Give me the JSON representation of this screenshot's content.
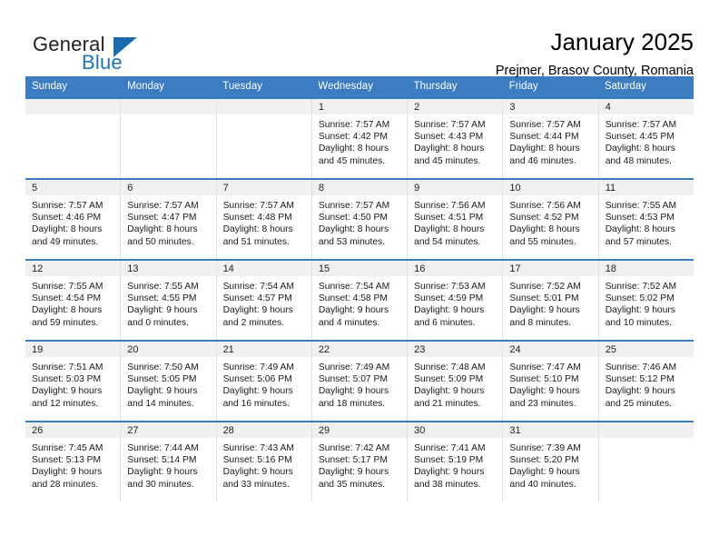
{
  "brand": {
    "name_part1": "General",
    "name_part2": "Blue",
    "triangle_color": "#1b6cb0",
    "blue_color": "#1b75bb"
  },
  "header": {
    "title": "January 2025",
    "subtitle": "Prejmer, Brasov County, Romania",
    "accent_color": "#3b7dc0"
  },
  "calendar": {
    "weekday_headers": [
      "Sunday",
      "Monday",
      "Tuesday",
      "Wednesday",
      "Thursday",
      "Friday",
      "Saturday"
    ],
    "labels": {
      "sunrise_prefix": "Sunrise:",
      "sunset_prefix": "Sunset:",
      "daylight_prefix": "Daylight:"
    },
    "weeks": [
      [
        {
          "day": "",
          "sunrise": "",
          "sunset": "",
          "daylight_line1": "",
          "daylight_line2": ""
        },
        {
          "day": "",
          "sunrise": "",
          "sunset": "",
          "daylight_line1": "",
          "daylight_line2": ""
        },
        {
          "day": "",
          "sunrise": "",
          "sunset": "",
          "daylight_line1": "",
          "daylight_line2": ""
        },
        {
          "day": "1",
          "sunrise": "Sunrise: 7:57 AM",
          "sunset": "Sunset: 4:42 PM",
          "daylight_line1": "Daylight: 8 hours",
          "daylight_line2": "and 45 minutes."
        },
        {
          "day": "2",
          "sunrise": "Sunrise: 7:57 AM",
          "sunset": "Sunset: 4:43 PM",
          "daylight_line1": "Daylight: 8 hours",
          "daylight_line2": "and 45 minutes."
        },
        {
          "day": "3",
          "sunrise": "Sunrise: 7:57 AM",
          "sunset": "Sunset: 4:44 PM",
          "daylight_line1": "Daylight: 8 hours",
          "daylight_line2": "and 46 minutes."
        },
        {
          "day": "4",
          "sunrise": "Sunrise: 7:57 AM",
          "sunset": "Sunset: 4:45 PM",
          "daylight_line1": "Daylight: 8 hours",
          "daylight_line2": "and 48 minutes."
        }
      ],
      [
        {
          "day": "5",
          "sunrise": "Sunrise: 7:57 AM",
          "sunset": "Sunset: 4:46 PM",
          "daylight_line1": "Daylight: 8 hours",
          "daylight_line2": "and 49 minutes."
        },
        {
          "day": "6",
          "sunrise": "Sunrise: 7:57 AM",
          "sunset": "Sunset: 4:47 PM",
          "daylight_line1": "Daylight: 8 hours",
          "daylight_line2": "and 50 minutes."
        },
        {
          "day": "7",
          "sunrise": "Sunrise: 7:57 AM",
          "sunset": "Sunset: 4:48 PM",
          "daylight_line1": "Daylight: 8 hours",
          "daylight_line2": "and 51 minutes."
        },
        {
          "day": "8",
          "sunrise": "Sunrise: 7:57 AM",
          "sunset": "Sunset: 4:50 PM",
          "daylight_line1": "Daylight: 8 hours",
          "daylight_line2": "and 53 minutes."
        },
        {
          "day": "9",
          "sunrise": "Sunrise: 7:56 AM",
          "sunset": "Sunset: 4:51 PM",
          "daylight_line1": "Daylight: 8 hours",
          "daylight_line2": "and 54 minutes."
        },
        {
          "day": "10",
          "sunrise": "Sunrise: 7:56 AM",
          "sunset": "Sunset: 4:52 PM",
          "daylight_line1": "Daylight: 8 hours",
          "daylight_line2": "and 55 minutes."
        },
        {
          "day": "11",
          "sunrise": "Sunrise: 7:55 AM",
          "sunset": "Sunset: 4:53 PM",
          "daylight_line1": "Daylight: 8 hours",
          "daylight_line2": "and 57 minutes."
        }
      ],
      [
        {
          "day": "12",
          "sunrise": "Sunrise: 7:55 AM",
          "sunset": "Sunset: 4:54 PM",
          "daylight_line1": "Daylight: 8 hours",
          "daylight_line2": "and 59 minutes."
        },
        {
          "day": "13",
          "sunrise": "Sunrise: 7:55 AM",
          "sunset": "Sunset: 4:55 PM",
          "daylight_line1": "Daylight: 9 hours",
          "daylight_line2": "and 0 minutes."
        },
        {
          "day": "14",
          "sunrise": "Sunrise: 7:54 AM",
          "sunset": "Sunset: 4:57 PM",
          "daylight_line1": "Daylight: 9 hours",
          "daylight_line2": "and 2 minutes."
        },
        {
          "day": "15",
          "sunrise": "Sunrise: 7:54 AM",
          "sunset": "Sunset: 4:58 PM",
          "daylight_line1": "Daylight: 9 hours",
          "daylight_line2": "and 4 minutes."
        },
        {
          "day": "16",
          "sunrise": "Sunrise: 7:53 AM",
          "sunset": "Sunset: 4:59 PM",
          "daylight_line1": "Daylight: 9 hours",
          "daylight_line2": "and 6 minutes."
        },
        {
          "day": "17",
          "sunrise": "Sunrise: 7:52 AM",
          "sunset": "Sunset: 5:01 PM",
          "daylight_line1": "Daylight: 9 hours",
          "daylight_line2": "and 8 minutes."
        },
        {
          "day": "18",
          "sunrise": "Sunrise: 7:52 AM",
          "sunset": "Sunset: 5:02 PM",
          "daylight_line1": "Daylight: 9 hours",
          "daylight_line2": "and 10 minutes."
        }
      ],
      [
        {
          "day": "19",
          "sunrise": "Sunrise: 7:51 AM",
          "sunset": "Sunset: 5:03 PM",
          "daylight_line1": "Daylight: 9 hours",
          "daylight_line2": "and 12 minutes."
        },
        {
          "day": "20",
          "sunrise": "Sunrise: 7:50 AM",
          "sunset": "Sunset: 5:05 PM",
          "daylight_line1": "Daylight: 9 hours",
          "daylight_line2": "and 14 minutes."
        },
        {
          "day": "21",
          "sunrise": "Sunrise: 7:49 AM",
          "sunset": "Sunset: 5:06 PM",
          "daylight_line1": "Daylight: 9 hours",
          "daylight_line2": "and 16 minutes."
        },
        {
          "day": "22",
          "sunrise": "Sunrise: 7:49 AM",
          "sunset": "Sunset: 5:07 PM",
          "daylight_line1": "Daylight: 9 hours",
          "daylight_line2": "and 18 minutes."
        },
        {
          "day": "23",
          "sunrise": "Sunrise: 7:48 AM",
          "sunset": "Sunset: 5:09 PM",
          "daylight_line1": "Daylight: 9 hours",
          "daylight_line2": "and 21 minutes."
        },
        {
          "day": "24",
          "sunrise": "Sunrise: 7:47 AM",
          "sunset": "Sunset: 5:10 PM",
          "daylight_line1": "Daylight: 9 hours",
          "daylight_line2": "and 23 minutes."
        },
        {
          "day": "25",
          "sunrise": "Sunrise: 7:46 AM",
          "sunset": "Sunset: 5:12 PM",
          "daylight_line1": "Daylight: 9 hours",
          "daylight_line2": "and 25 minutes."
        }
      ],
      [
        {
          "day": "26",
          "sunrise": "Sunrise: 7:45 AM",
          "sunset": "Sunset: 5:13 PM",
          "daylight_line1": "Daylight: 9 hours",
          "daylight_line2": "and 28 minutes."
        },
        {
          "day": "27",
          "sunrise": "Sunrise: 7:44 AM",
          "sunset": "Sunset: 5:14 PM",
          "daylight_line1": "Daylight: 9 hours",
          "daylight_line2": "and 30 minutes."
        },
        {
          "day": "28",
          "sunrise": "Sunrise: 7:43 AM",
          "sunset": "Sunset: 5:16 PM",
          "daylight_line1": "Daylight: 9 hours",
          "daylight_line2": "and 33 minutes."
        },
        {
          "day": "29",
          "sunrise": "Sunrise: 7:42 AM",
          "sunset": "Sunset: 5:17 PM",
          "daylight_line1": "Daylight: 9 hours",
          "daylight_line2": "and 35 minutes."
        },
        {
          "day": "30",
          "sunrise": "Sunrise: 7:41 AM",
          "sunset": "Sunset: 5:19 PM",
          "daylight_line1": "Daylight: 9 hours",
          "daylight_line2": "and 38 minutes."
        },
        {
          "day": "31",
          "sunrise": "Sunrise: 7:39 AM",
          "sunset": "Sunset: 5:20 PM",
          "daylight_line1": "Daylight: 9 hours",
          "daylight_line2": "and 40 minutes."
        },
        {
          "day": "",
          "sunrise": "",
          "sunset": "",
          "daylight_line1": "",
          "daylight_line2": ""
        }
      ]
    ]
  }
}
